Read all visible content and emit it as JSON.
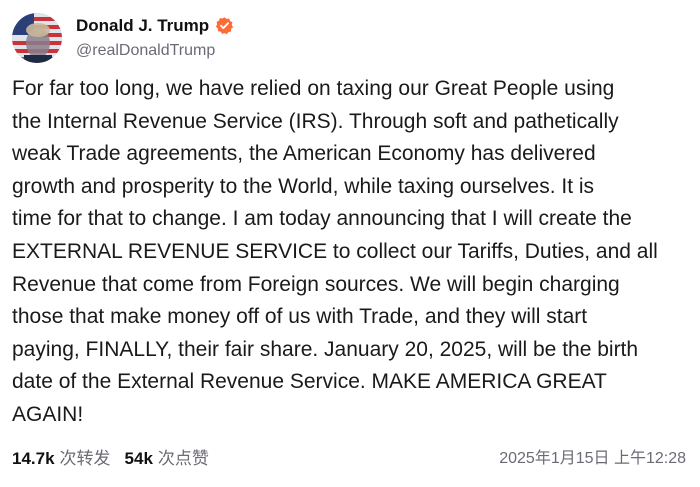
{
  "author": {
    "display_name": "Donald J. Trump",
    "handle": "@realDonaldTrump",
    "verified": true,
    "verified_color": "#ff6b35"
  },
  "post": {
    "lines": [
      "For far too long, we have relied on taxing our Great People using",
      "the Internal Revenue Service (IRS). Through soft and pathetically",
      "weak Trade agreements, the American Economy has delivered",
      "growth and prosperity to the World, while taxing ourselves. It is",
      "time for that to change. I am today announcing that I will create the",
      "EXTERNAL REVENUE SERVICE to collect our Tariffs, Duties, and all",
      "Revenue that come from Foreign sources. We will begin charging",
      "those that make money off of us with Trade, and they will start",
      "paying, FINALLY, their fair share. January 20, 2025, will be the birth",
      "date of the External Revenue Service. MAKE AMERICA GREAT",
      "AGAIN!"
    ]
  },
  "footer": {
    "reposts_count": "14.7k",
    "reposts_label": "次转发",
    "likes_count": "54k",
    "likes_label": "次点赞",
    "timestamp": "2025年1月15日 上午12:28"
  }
}
